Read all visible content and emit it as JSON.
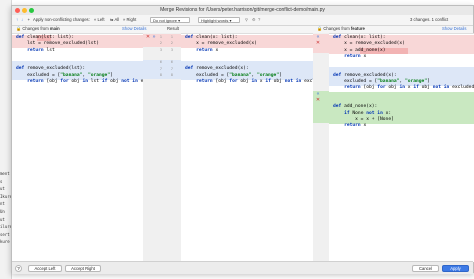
{
  "window": {
    "title": "Merge Revisions for /Users/peter.harrison/git/merge-conflict-demo/main.py"
  },
  "toolbar": {
    "apply_label": "Apply non-conflicting changes:",
    "left_label": "Left",
    "all_label": "All",
    "right_label": "Right",
    "ignore_label": "Do not ignore",
    "highlight_label": "Highlight words",
    "changes_status": "3 changes. 1 conflict"
  },
  "left_pane": {
    "header_prefix": "Changes from",
    "header_branch": "main",
    "show_details": "Show Details"
  },
  "result_pane": {
    "header": "Result"
  },
  "right_pane": {
    "header_prefix": "Changes from",
    "header_branch": "feature",
    "show_details": "Show Details"
  },
  "ide": {
    "side_lines": [
      "ment",
      "s",
      "ut",
      "Ikure",
      "nt",
      "Un",
      "ut",
      "ilure",
      "sert",
      "kure"
    ]
  },
  "footer": {
    "help": "?",
    "accept_left": "Accept Left",
    "accept_right": "Accept Right",
    "cancel": "Cancel",
    "apply": "Apply"
  },
  "colors": {
    "conflict_red": "#f8d7d7",
    "modified_blue": "#dde7f7",
    "added_green": "#c9e8c1",
    "primary_button": "#3d7ae6"
  }
}
